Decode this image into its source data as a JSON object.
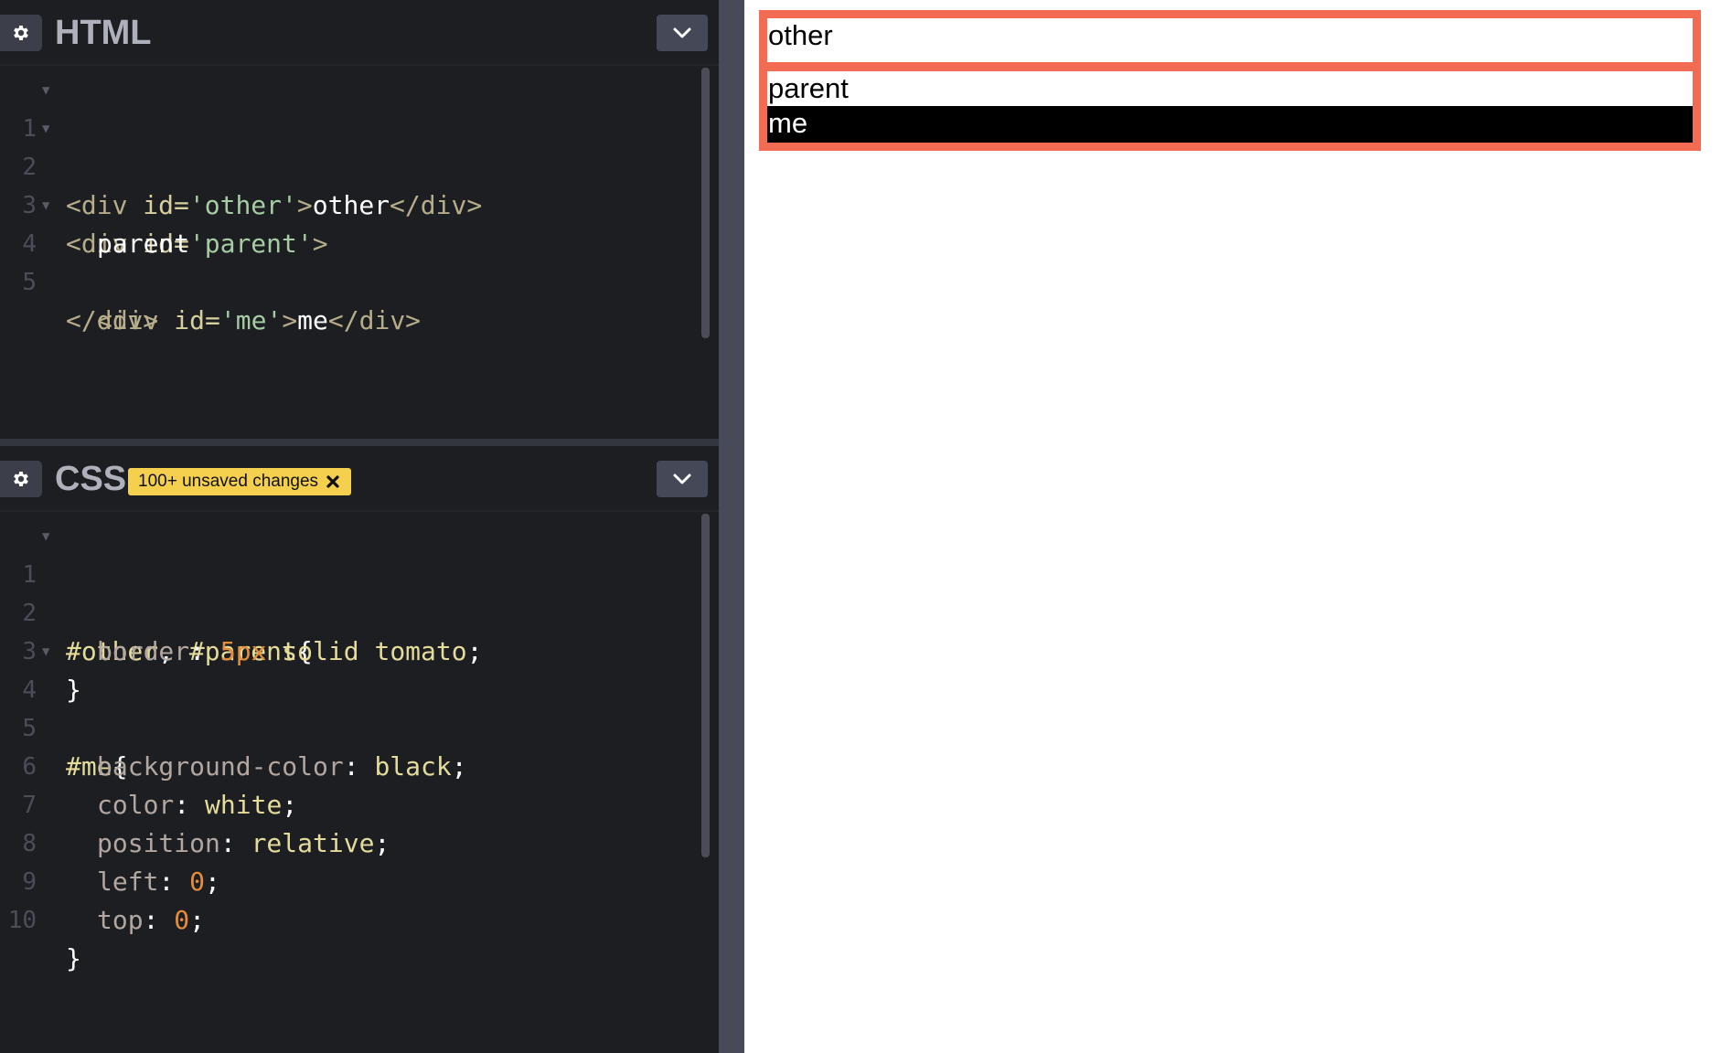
{
  "colors": {
    "editor_bg": "#1d1e22",
    "splitter": "#464a59",
    "accent_tomato": "#f26b53",
    "badge_yellow": "#f5d04e"
  },
  "html_panel": {
    "title": "HTML",
    "settings_icon": "gear-icon",
    "collapse_icon": "chevron-down-icon",
    "lines": [
      {
        "n": "1",
        "fold": true
      },
      {
        "n": "2",
        "fold": true
      },
      {
        "n": "3",
        "fold": false
      },
      {
        "n": "4",
        "fold": true
      },
      {
        "n": "5",
        "fold": false
      }
    ],
    "code": {
      "l1_open": "<div ",
      "l1_attr": "id=",
      "l1_str": "'other'",
      "l1_close": ">",
      "l1_text": "other",
      "l1_end": "</div>",
      "l2_open": "<div ",
      "l2_attr": "id=",
      "l2_str": "'parent'",
      "l2_close": ">",
      "l3_text": "parent",
      "l4_open": "<div ",
      "l4_attr": "id=",
      "l4_str": "'me'",
      "l4_close": ">",
      "l4_text": "me",
      "l4_end": "</div>",
      "l5_end": "</div>"
    }
  },
  "css_panel": {
    "title": "CSS",
    "badge_text": "100+ unsaved changes",
    "settings_icon": "gear-icon",
    "collapse_icon": "chevron-down-icon",
    "lines": [
      {
        "n": "1"
      },
      {
        "n": "2"
      },
      {
        "n": "3"
      },
      {
        "n": "4"
      },
      {
        "n": "5"
      },
      {
        "n": "6"
      },
      {
        "n": "7"
      },
      {
        "n": "8"
      },
      {
        "n": "9"
      },
      {
        "n": "10"
      }
    ],
    "code": {
      "l1_sel": "#other",
      "l1_comma": ", ",
      "l1_sel2": "#parent",
      "l1_brace": "{",
      "l2_prop": "border",
      "l2_colon": ": ",
      "l2_num": "5px",
      "l2_val": " solid tomato",
      "l2_semi": ";",
      "l3_brace": "}",
      "l4_sel": "#me",
      "l4_brace": "{",
      "l5_prop": "background-color",
      "l5_colon": ": ",
      "l5_val": "black",
      "l5_semi": ";",
      "l6_prop": "color",
      "l6_colon": ": ",
      "l6_val": "white",
      "l6_semi": ";",
      "l7_prop": "position",
      "l7_colon": ": ",
      "l7_val": "relative",
      "l7_semi": ";",
      "l8_prop": "left",
      "l8_colon": ": ",
      "l8_num": "0",
      "l8_semi": ";",
      "l9_prop": "top",
      "l9_colon": ": ",
      "l9_num": "0",
      "l9_semi": ";",
      "l10_brace": "}"
    }
  },
  "preview": {
    "other_text": "other",
    "parent_text": "parent",
    "me_text": "me"
  }
}
